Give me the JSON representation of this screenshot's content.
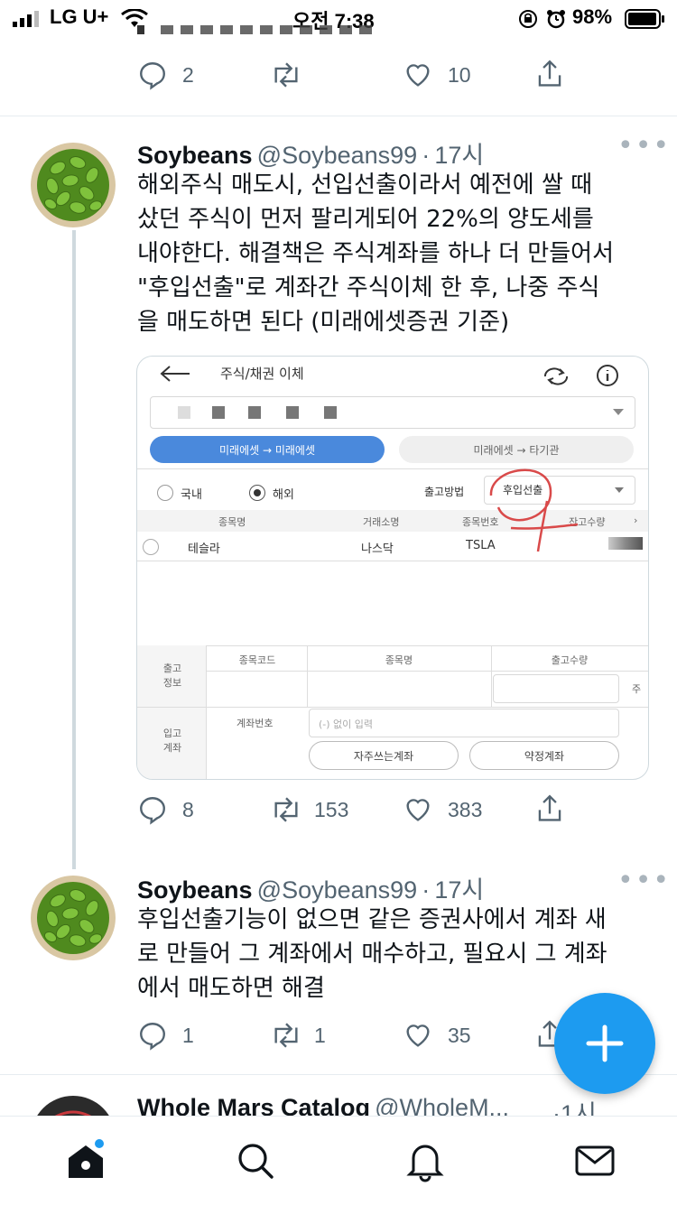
{
  "status_bar": {
    "carrier": "LG U+",
    "time": "오전 7:38",
    "battery": "98%"
  },
  "prev_tweet": {
    "reply_count": "2",
    "like_count": "10"
  },
  "tweet1": {
    "name": "Soybeans",
    "handle": "@Soybeans99",
    "dot": "·",
    "time": "17시",
    "text": "해외주식 매도시, 선입선출이라서 예전에 쌀 때\n샀던 주식이 먼저 팔리게되어 22%의 양도세를\n내야한다. 해결책은 주식계좌를 하나 더 만들어서\n\"후입선출\"로 계좌간 주식이체 한 후, 나중 주식\n을 매도하면 된다 (미래에셋증권 기준)",
    "reply_count": "8",
    "retweet_count": "153",
    "like_count": "383"
  },
  "embed": {
    "title": "주식/채권 이체",
    "tab_active": "미래에셋 → 미래에셋",
    "tab_inactive": "미래에셋 → 타기관",
    "radio_domestic": "국내",
    "radio_overseas": "해외",
    "method_label": "출고방법",
    "method_value": "후입선출",
    "headers": [
      "종목명",
      "거래소명",
      "종목번호",
      "잔고수량"
    ],
    "row": {
      "name": "테슬라",
      "exchange": "나스닥",
      "code": "TSLA"
    },
    "out_label": "출고\n정보",
    "out_headers": [
      "종목코드",
      "종목명",
      "출고수량"
    ],
    "unit": "주",
    "in_label": "입고\n계좌",
    "account_label": "계좌번호",
    "account_placeholder": "(-) 없이 입력",
    "btn_frequent": "자주쓰는계좌",
    "btn_contract": "약정계좌"
  },
  "tweet2": {
    "name": "Soybeans",
    "handle": "@Soybeans99",
    "dot": "·",
    "time": "17시",
    "text": "후입선출기능이 없으면 같은 증권사에서 계좌 새\n로 만들어 그 계좌에서 매수하고, 필요시 그 계좌\n에서 매도하면 해결",
    "reply_count": "1",
    "retweet_count": "1",
    "like_count": "35"
  },
  "tweet3": {
    "name": "Whole Mars Catalog",
    "handle": "@WholeM...",
    "time": "·1시"
  },
  "nav": [
    "home-icon",
    "search-icon",
    "notifications-icon",
    "messages-icon"
  ],
  "colors": {
    "accent": "#1d9bf0",
    "embed_tab": "#4a89dc",
    "annotation": "#d94a4a"
  }
}
